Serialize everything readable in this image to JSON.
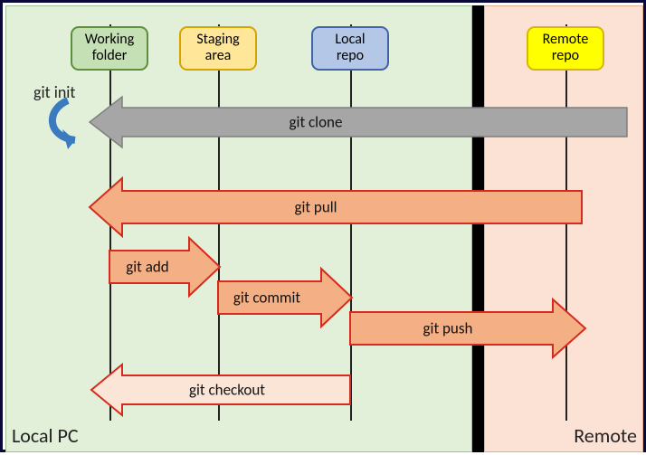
{
  "regions": {
    "local_label": "Local PC",
    "remote_label": "Remote"
  },
  "lanes": {
    "working": "Working\nfolder",
    "staging": "Staging\narea",
    "local_repo": "Local\nrepo",
    "remote_repo": "Remote\nrepo"
  },
  "commands": {
    "git_init": "git init",
    "git_clone": "git clone",
    "git_pull": "git pull",
    "git_add": "git add",
    "git_commit": "git commit",
    "git_push": "git push",
    "git_checkout": "git checkout"
  },
  "colors": {
    "clone_fill": "#a6a6a6",
    "orange_fill": "#f4b084",
    "orange_stroke": "#d52b1e",
    "checkout_fill": "#fbe5d6",
    "init_arrow": "#3a7bbf"
  },
  "diagram_flow": [
    {
      "command": "git init",
      "from": null,
      "to": "working_folder",
      "direction": "self"
    },
    {
      "command": "git clone",
      "from": "remote_repo",
      "to": "working_folder",
      "direction": "left"
    },
    {
      "command": "git pull",
      "from": "remote_repo",
      "to": "working_folder",
      "direction": "left"
    },
    {
      "command": "git add",
      "from": "working_folder",
      "to": "staging_area",
      "direction": "right"
    },
    {
      "command": "git commit",
      "from": "staging_area",
      "to": "local_repo",
      "direction": "right"
    },
    {
      "command": "git push",
      "from": "local_repo",
      "to": "remote_repo",
      "direction": "right"
    },
    {
      "command": "git checkout",
      "from": "local_repo",
      "to": "working_folder",
      "direction": "left"
    }
  ]
}
